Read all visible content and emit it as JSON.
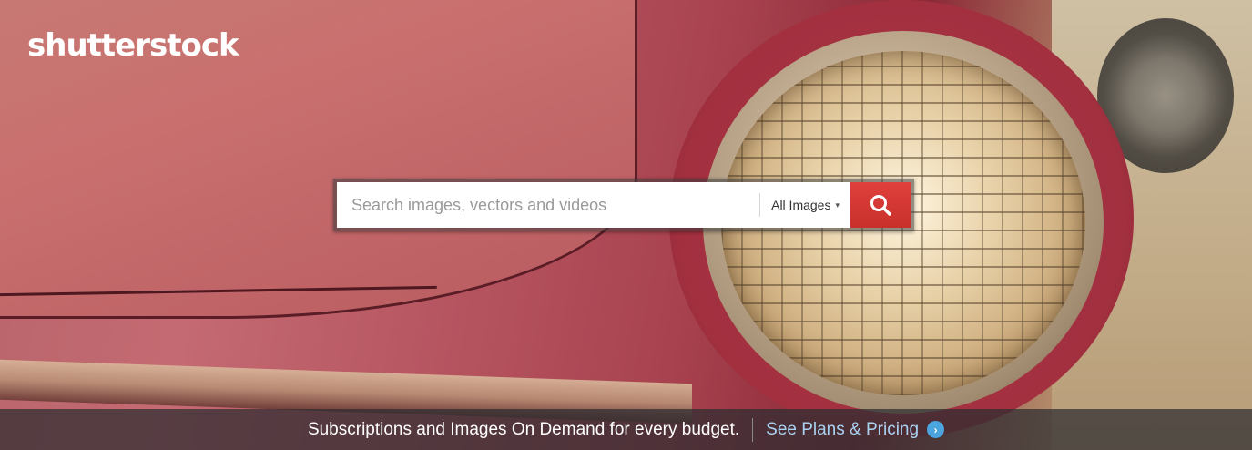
{
  "header": {
    "logo_text": "shutterstock"
  },
  "search": {
    "placeholder": "Search images, vectors and videos",
    "type_selected": "All Images",
    "type_caret": "▾",
    "button_icon": "search-icon"
  },
  "promo": {
    "text": "Subscriptions and Images On Demand for every budget.",
    "link_label": "See Plans & Pricing",
    "link_icon": "chevron-right-circle-icon"
  },
  "colors": {
    "search_button": "#d23a36",
    "link": "#a9d2f2",
    "link_arrow_bg": "#4aa4dd"
  }
}
